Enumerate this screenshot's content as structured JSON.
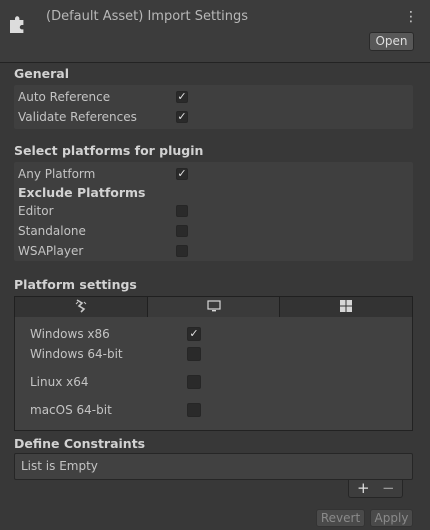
{
  "header": {
    "title": "(Default Asset) Import Settings",
    "open_label": "Open",
    "menu_glyph": "⋮",
    "icon": "plugin-puzzle-icon"
  },
  "general": {
    "title": "General",
    "auto_reference": {
      "label": "Auto Reference",
      "checked": true
    },
    "validate_references": {
      "label": "Validate References",
      "checked": true
    }
  },
  "platforms": {
    "title": "Select platforms for plugin",
    "any_platform": {
      "label": "Any Platform",
      "checked": true
    },
    "exclude_title": "Exclude Platforms",
    "exclude": [
      {
        "label": "Editor",
        "checked": false
      },
      {
        "label": "Standalone",
        "checked": false
      },
      {
        "label": "WSAPlayer",
        "checked": false
      }
    ]
  },
  "platform_settings": {
    "title": "Platform settings",
    "tabs": [
      {
        "icon": "unity-editor-icon",
        "active": false
      },
      {
        "icon": "monitor-icon",
        "active": true
      },
      {
        "icon": "windows-logo-icon",
        "active": false
      }
    ],
    "items": [
      {
        "label": "Windows x86",
        "checked": true
      },
      {
        "label": "Windows 64-bit",
        "checked": false
      },
      {
        "label": "Linux x64",
        "checked": false
      },
      {
        "label": "macOS 64-bit",
        "checked": false
      }
    ]
  },
  "define_constraints": {
    "title": "Define Constraints",
    "empty_text": "List is Empty",
    "add_glyph": "+",
    "remove_glyph": "−"
  },
  "footer": {
    "revert_label": "Revert",
    "apply_label": "Apply"
  },
  "check_glyph": "✓"
}
